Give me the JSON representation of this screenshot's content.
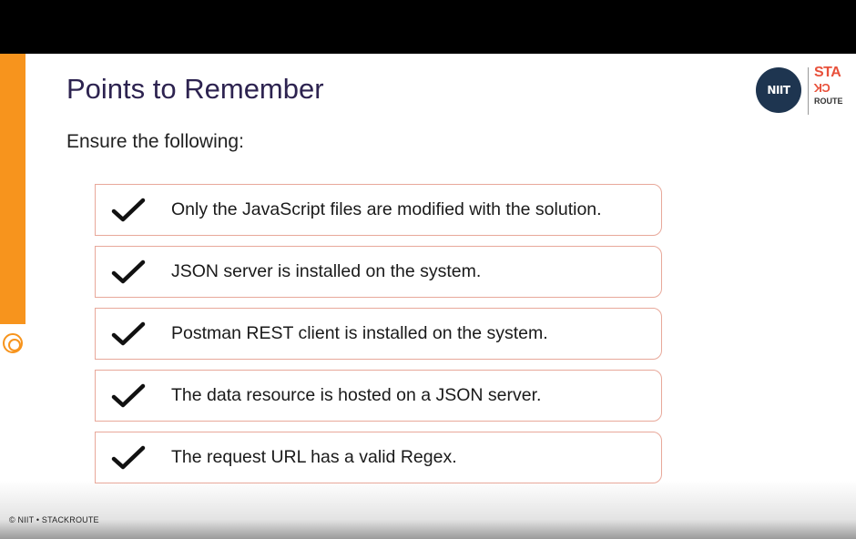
{
  "slide": {
    "title": "Points to Remember",
    "subtitle": "Ensure the following:",
    "items": [
      "Only the JavaScript files are modified with the solution.",
      "JSON server is installed on the system.",
      "Postman REST client is installed on the system.",
      "The data resource is hosted on a JSON server.",
      "The request URL has a valid Regex."
    ],
    "footer": "© NIIT • STACKROUTE"
  },
  "logo": {
    "niit": "NIIT",
    "stack_top": "STA",
    "stack_mid": "CK",
    "stack_bottom": "ROUTE"
  },
  "colors": {
    "accent": "#f7941d",
    "title": "#2d2350",
    "item_border": "#e8a89a",
    "niit_badge": "#1e3550",
    "stackroute": "#e8503a"
  },
  "icons": {
    "ring": "ring-icon",
    "check": "check-icon"
  }
}
